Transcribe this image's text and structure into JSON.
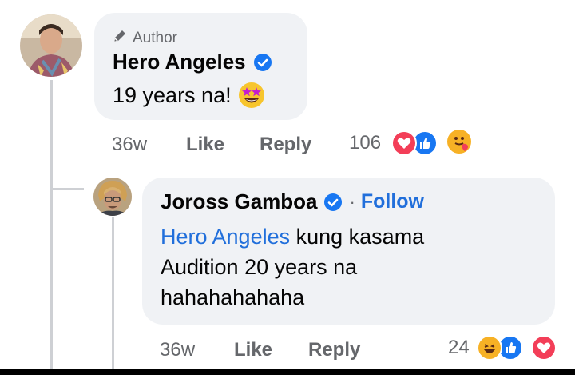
{
  "comment1": {
    "author_tag": "Author",
    "name": "Hero Angeles",
    "text": "19 years na!",
    "time": "36w",
    "like": "Like",
    "reply": "Reply",
    "reaction_count": "106",
    "reactions": [
      "love",
      "like",
      "care"
    ]
  },
  "comment2": {
    "name": "Joross Gamboa",
    "separator": "·",
    "follow": "Follow",
    "mention": "Hero Angeles",
    "text_line1_rest": " kung kasama",
    "text_line2": "Audition 20 years na",
    "text_line3": "hahahahahaha",
    "time": "36w",
    "like": "Like",
    "reply": "Reply",
    "reaction_count": "24",
    "reactions": [
      "haha",
      "like",
      "love"
    ]
  },
  "colors": {
    "link": "#216fdb",
    "verified": "#1877f2",
    "love": "#f33e58",
    "like": "#1877f2",
    "haha": "#f7b125"
  }
}
